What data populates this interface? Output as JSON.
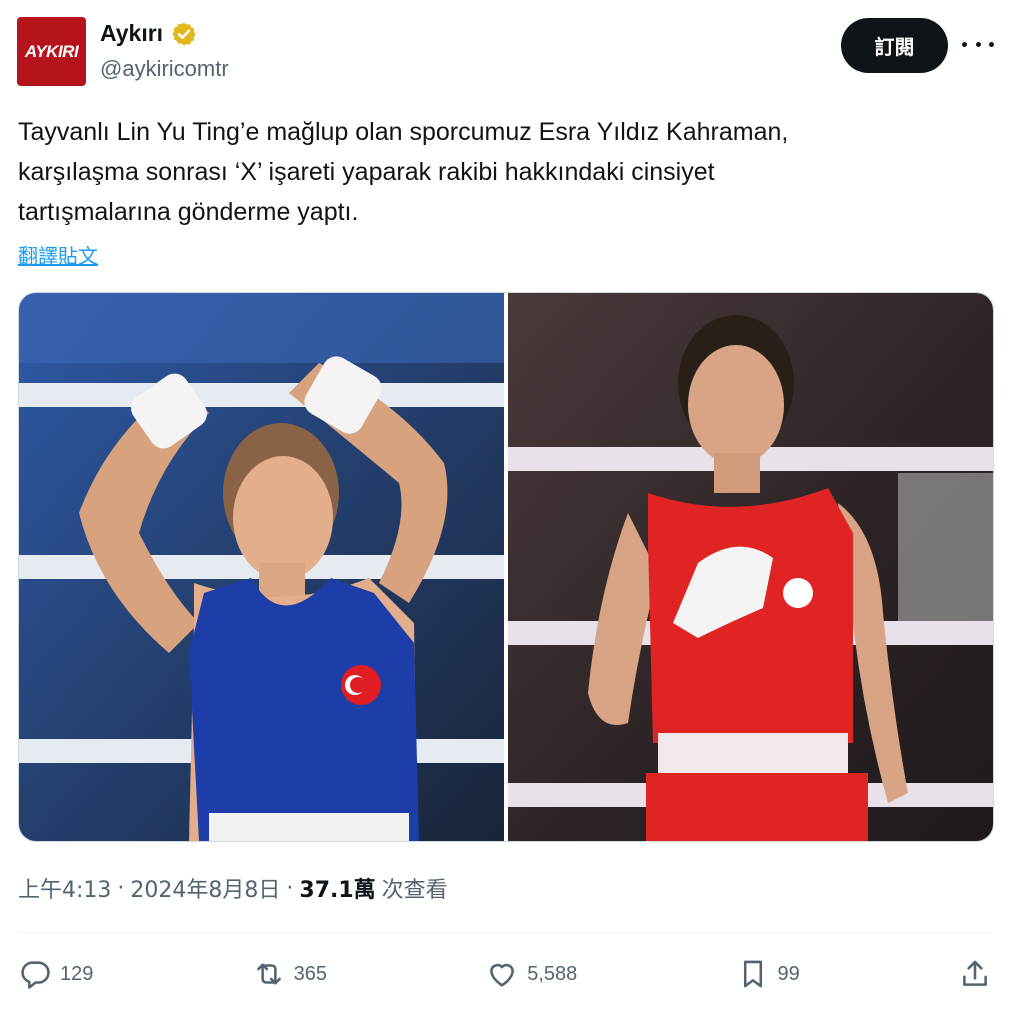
{
  "account": {
    "avatar_text": "AYKIRI",
    "display_name": "Aykırı",
    "handle": "@aykiricomtr"
  },
  "header": {
    "subscribe_label": "訂閱"
  },
  "tweet": {
    "text": "Tayvanlı Lin Yu Ting’e mağlup olan sporcumuz Esra Yıldız Kahraman,\nkarşılaşma sonrası ‘X’ işareti yaparak rakibi hakkındaki cinsiyet\ntartışmalarına gönderme yaptı.",
    "translate_label": "翻譯貼文"
  },
  "meta": {
    "time": "上午4:13",
    "sep1": "·",
    "date": "2024年8月8日",
    "sep2": "·",
    "views_count": "37.1萬",
    "views_label": "次查看"
  },
  "actions": {
    "replies": "129",
    "reposts": "365",
    "likes": "5,588",
    "bookmarks": "99"
  },
  "colors": {
    "accent": "#1d9bf0",
    "avatar_bg": "#b5141c",
    "verified_badge": "#e2b719",
    "blue_jersey": "#1d3ea8",
    "red_jersey": "#e02424"
  }
}
